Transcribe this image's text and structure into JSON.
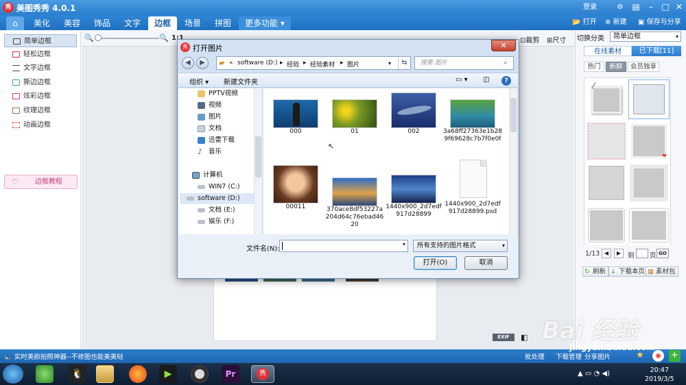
{
  "app": {
    "logo_text": "秀",
    "title": "美图秀秀 4.0.1",
    "login": "登录"
  },
  "tabs": [
    "美化",
    "美容",
    "饰品",
    "文字",
    "边框",
    "场景",
    "拼图",
    "更多功能"
  ],
  "active_tab": "边框",
  "top_actions": {
    "open": "打开",
    "new": "新建",
    "save_share": "保存与分享"
  },
  "toolbar": {
    "zoom_ratio": "1:1",
    "crop": "裁剪",
    "size": "尺寸"
  },
  "left_menu": [
    {
      "label": "简单边框",
      "selected": true
    },
    {
      "label": "轻松边框",
      "selected": false
    },
    {
      "label": "文字边框",
      "selected": false
    },
    {
      "label": "撕边边框",
      "selected": false
    },
    {
      "label": "炫彩边框",
      "selected": false
    },
    {
      "label": "纹理边框",
      "selected": false
    },
    {
      "label": "动画边框",
      "selected": false
    }
  ],
  "tutorial_button": "边框教程",
  "right_panel": {
    "switch_label": "切换分类",
    "category_value": "简单边框",
    "tabs": [
      "在线素材",
      "已下载[11]"
    ],
    "subtabs": [
      "热门",
      "新鲜",
      "会员独享"
    ],
    "pager_text": "1/13",
    "goto_label": "到",
    "page_label": "页",
    "go": "GO",
    "buttons": [
      "刷新",
      "下载本页",
      "素材包"
    ]
  },
  "dialog": {
    "title": "打开图片",
    "breadcrumb": [
      "software (D:)",
      "经验",
      "经验素材",
      "图片"
    ],
    "search_placeholder": "搜索 图片",
    "organize": "组织",
    "new_folder": "新建文件夹",
    "nav_items": [
      "PPTV视频",
      "视频",
      "图片",
      "文档",
      "迅雷下载",
      "音乐",
      "计算机",
      "WIN7 (C:)",
      "software (D:)",
      "文档 (E:)",
      "娱乐 (F:)"
    ],
    "nav_selected": "software (D:)",
    "files": [
      "000",
      "01",
      "002",
      "3a68ff27363e1b289f69628c7b7f0e0f",
      "00011",
      "370ace8df53227a204d64c76ebad4620",
      "1440x900_2d7edf917d28899",
      "1440x900_2d7edf917d28899.psd"
    ],
    "filename_label": "文件名(N):",
    "filename_value": "",
    "filter": "所有支持的图片格式",
    "open_button": "打开(O)",
    "cancel_button": "取消"
  },
  "status": {
    "message": "实时美颜拍照神器--不修图也能美美哒",
    "batch": "批处理",
    "downloads": "下载管理",
    "share": "分享图片",
    "exif": "EXIF"
  },
  "taskbar": {
    "time": "20:47",
    "date": "2019/3/5"
  },
  "watermark": {
    "logo": "Bai 经验",
    "url": "jingyan.baidu.com"
  },
  "colors": {
    "titlebar": "#2c7fcf",
    "accent": "#1f6fc0",
    "close_red": "#c5432d",
    "statusbar": "#1d66b2"
  }
}
